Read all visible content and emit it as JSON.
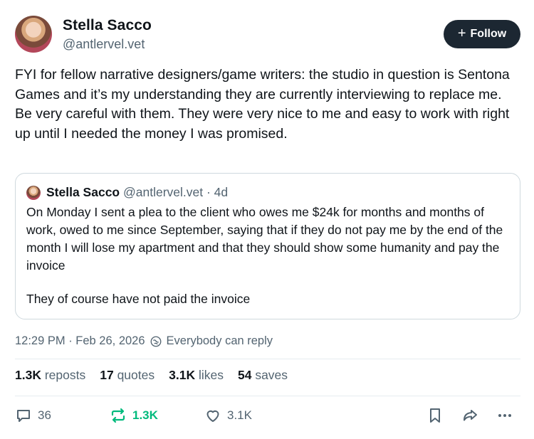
{
  "author": {
    "name": "Stella Sacco",
    "handle": "@antlervel.vet"
  },
  "follow_label": "Follow",
  "post_text": "FYI for fellow narrative designers/game writers: the studio in question is Sentona Games and it’s my understanding they are currently interviewing to replace me. Be very careful with them. They were very nice to me and easy to work with right up until I needed the money I was promised.",
  "quoted": {
    "name": "Stella Sacco",
    "handle_age": "@antlervel.vet · 4d",
    "text": "On Monday I sent a plea to the client who owes me $24k for months and months of work, owed to me since September, saying that if they do not pay me by the end of the month I will lose my apartment and that they should show some humanity and pay the invoice",
    "text2": "They of course have not paid the invoice"
  },
  "timestamp": "12:29 PM · Feb 26, 2026",
  "reply_setting": "Everybody can reply",
  "stats": {
    "reposts_count": "1.3K",
    "reposts_label": "reposts",
    "quotes_count": "17",
    "quotes_label": "quotes",
    "likes_count": "3.1K",
    "likes_label": "likes",
    "saves_count": "54",
    "saves_label": "saves"
  },
  "actions": {
    "replies": "36",
    "reposts": "1.3K",
    "likes": "3.1K"
  },
  "colors": {
    "follow_bg": "#1c2732",
    "repost_active": "#00ba7c",
    "secondary_text": "#536471"
  }
}
